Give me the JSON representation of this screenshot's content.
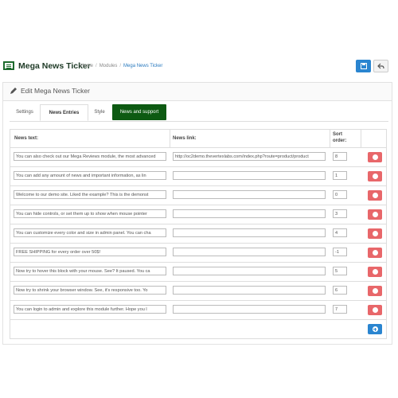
{
  "header": {
    "app_title": "Mega News Ticker",
    "breadcrumb": [
      "Home",
      "Modules",
      "Mega News Ticker"
    ]
  },
  "panel": {
    "title": "Edit Mega News Ticker"
  },
  "tabs": [
    {
      "label": "Settings",
      "active": false
    },
    {
      "label": "News Entries",
      "active": true
    },
    {
      "label": "Style",
      "active": false
    },
    {
      "label": "News and support",
      "active": false
    }
  ],
  "table": {
    "headers": {
      "news_text": "News text:",
      "news_link": "News link:",
      "sort_order_line1": "Sort",
      "sort_order_line2": "order:"
    },
    "rows": [
      {
        "text": "You can also check out our Mega Reviews module, the most advanced",
        "link": "http://oc2demo.thevertexlabs.com/index.php?route=product/product",
        "sort": "8"
      },
      {
        "text": "You can add any amount of news and important information, as lin",
        "link": "",
        "sort": "1"
      },
      {
        "text": "Welcome to our demo site. Liked the example?  This is the demonst",
        "link": "",
        "sort": "0"
      },
      {
        "text": "You can hide controls, or set them up to show when mouse pointer",
        "link": "",
        "sort": "3"
      },
      {
        "text": "You can customize every color and size in admin panel. You can cha",
        "link": "",
        "sort": "4"
      },
      {
        "text": "FREE SHIPPING for every order over 50$!",
        "link": "",
        "sort": "-1"
      },
      {
        "text": "Now try to hover this block with your mouse. See? It paused. You ca",
        "link": "",
        "sort": "5"
      },
      {
        "text": "Now try to shrink your browser window. See, it's responsive too. Yo",
        "link": "",
        "sort": "6"
      },
      {
        "text": "You can login to admin and explore this module further. Hope you l",
        "link": "",
        "sort": "7"
      }
    ]
  },
  "colors": {
    "brand_green": "#0d5a12",
    "primary_blue": "#2a85d0",
    "danger_red": "#e8676a"
  }
}
